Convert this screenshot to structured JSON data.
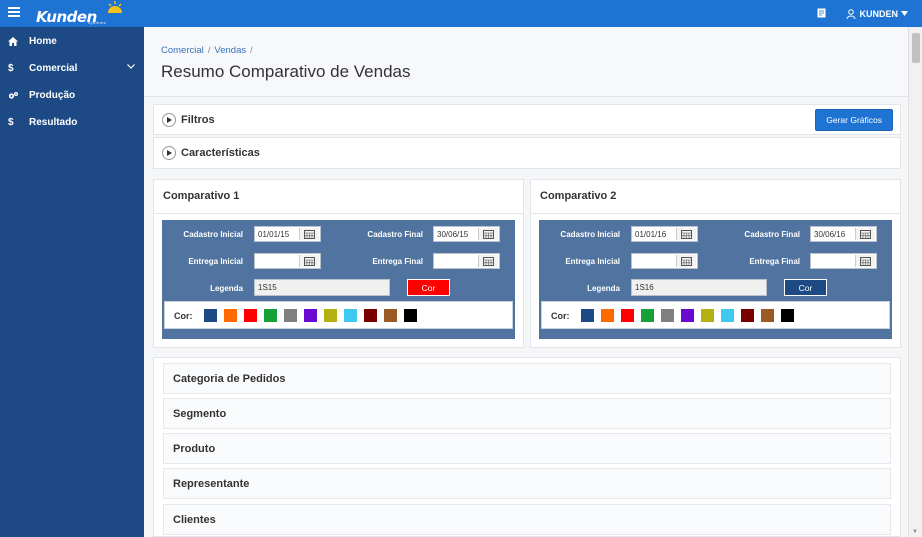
{
  "topbar": {
    "logo_text": "Kunden",
    "logo_subtext": "systems",
    "user_label": "KUNDEN",
    "icons": [
      "menu-icon",
      "document-icon",
      "user-icon",
      "caret-down-icon"
    ]
  },
  "sidebar": {
    "items": [
      {
        "label": "Home",
        "icon": "home-icon"
      },
      {
        "label": "Comercial",
        "icon": "dollar-icon",
        "has_submenu": true
      },
      {
        "label": "Produção",
        "icon": "gears-icon"
      },
      {
        "label": "Resultado",
        "icon": "dollar-icon"
      }
    ]
  },
  "header": {
    "breadcrumb": [
      "Comercial",
      "Vendas"
    ],
    "title": "Resumo Comparativo de Vendas"
  },
  "filtros": {
    "label": "Filtros",
    "button_label": "Gerar Gráficos"
  },
  "caracteristicas": {
    "label": "Características"
  },
  "comparativos": [
    {
      "title": "Comparativo 1",
      "cadastro_inicial_label": "Cadastro Inicial",
      "cadastro_inicial": "01/01/15",
      "cadastro_final_label": "Cadastro Final",
      "cadastro_final": "30/06/15",
      "entrega_inicial_label": "Entrega Inicial",
      "entrega_inicial": "",
      "entrega_final_label": "Entrega Final",
      "entrega_final": "",
      "legenda_label": "Legenda",
      "legenda": "1S15",
      "cor_button": "Cor",
      "cor_button_color": "#ff0000",
      "cor_label": "Cor:"
    },
    {
      "title": "Comparativo 2",
      "cadastro_inicial_label": "Cadastro Inicial",
      "cadastro_inicial": "01/01/16",
      "cadastro_final_label": "Cadastro Final",
      "cadastro_final": "30/06/16",
      "entrega_inicial_label": "Entrega Inicial",
      "entrega_inicial": "",
      "entrega_final_label": "Entrega Final",
      "entrega_final": "",
      "legenda_label": "Legenda",
      "legenda": "1S16",
      "cor_button": "Cor",
      "cor_button_color": "#1d4a85",
      "cor_label": "Cor:"
    }
  ],
  "palette": [
    "#1d4a85",
    "#ff6a00",
    "#ff0000",
    "#16a038",
    "#808080",
    "#6a0ad1",
    "#b5b012",
    "#3fc8f0",
    "#7a0000",
    "#9a5a24",
    "#000000"
  ],
  "categories": [
    "Categoria de Pedidos",
    "Segmento",
    "Produto",
    "Representante",
    "Clientes"
  ]
}
